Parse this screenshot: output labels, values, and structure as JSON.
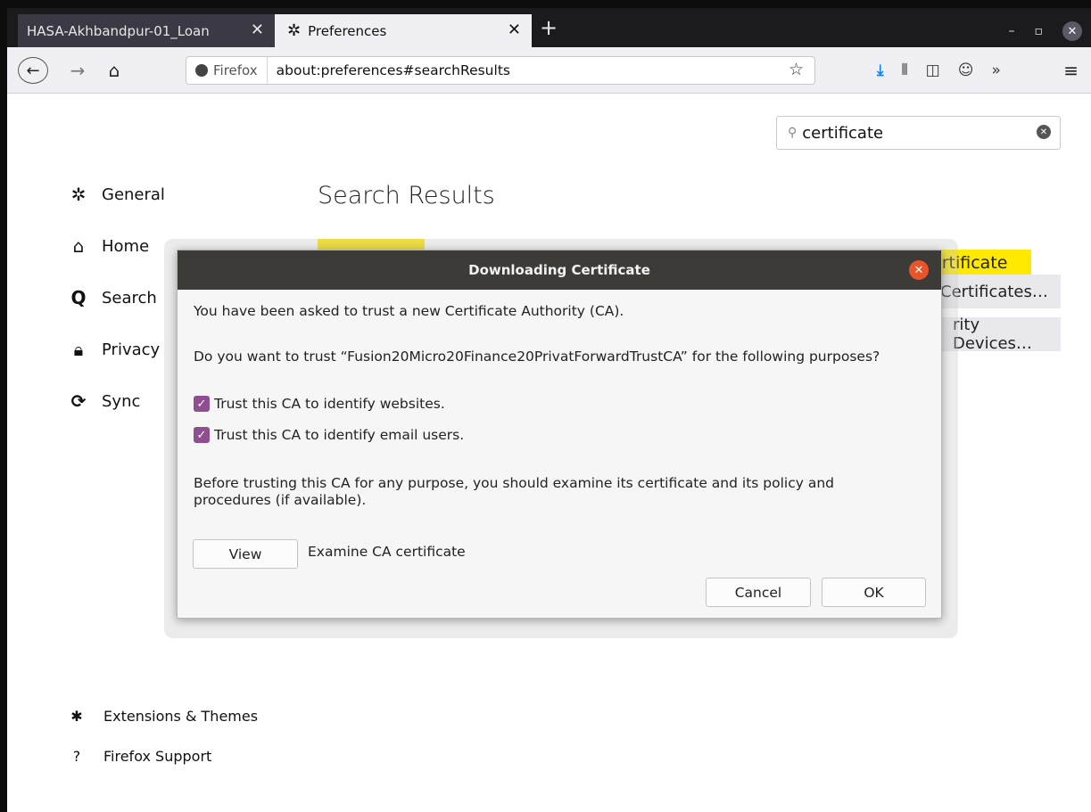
{
  "tabs": [
    {
      "title": "HASA-Akhbandpur-01_Loan",
      "close": "✕"
    },
    {
      "title": "Preferences",
      "icon": "gear-icon",
      "close": "✕"
    }
  ],
  "new_tab": "+",
  "window_controls": {
    "minimize": "–",
    "restore": "▫",
    "close": "✕"
  },
  "nav": {
    "back": "←",
    "forward": "→",
    "home": "⌂",
    "identity": "Firefox",
    "url": "about:preferences#searchResults",
    "star": "☆"
  },
  "toolbar_icons": {
    "download": "⤓",
    "library": "⫴",
    "sidebar": "◫",
    "account": "☺",
    "overflow": "»",
    "menu": "≡"
  },
  "search": {
    "value": "certificate",
    "clear": "✕"
  },
  "categories": [
    {
      "label": "General",
      "icon": "gear-icon",
      "glyph": "✲"
    },
    {
      "label": "Home",
      "icon": "home-icon",
      "glyph": "⌂"
    },
    {
      "label": "Search",
      "icon": "search-icon",
      "glyph": "Q"
    },
    {
      "label": "Privacy",
      "icon": "lock-icon",
      "glyph": "🔒︎"
    },
    {
      "label": "Sync",
      "icon": "sync-icon",
      "glyph": "⟳"
    }
  ],
  "results": {
    "title": "Search Results",
    "btn1": "ertificate",
    "btn2": "Certificates…",
    "btn3": "rity Devices…"
  },
  "footer": [
    {
      "label": "Extensions & Themes",
      "icon": "puzzle-icon",
      "glyph": "✱"
    },
    {
      "label": "Firefox Support",
      "icon": "help-icon",
      "glyph": "?"
    }
  ],
  "dialog": {
    "title": "Downloading Certificate",
    "line1": "You have been asked to trust a new Certificate Authority (CA).",
    "line2": "Do you want to trust “Fusion20Micro20Finance20PrivatForwardTrustCA” for the following purposes?",
    "check1": "Trust this CA to identify websites.",
    "check2": "Trust this CA to identify email users.",
    "line3": "Before trusting this CA for any purpose, you should examine its certificate and its policy and procedures (if available).",
    "view_button": "View",
    "view_desc": "Examine CA certificate",
    "cancel_button": "Cancel",
    "ok_button": "OK",
    "check1_checked": true,
    "check2_checked": true
  },
  "colors": {
    "checkbox": "#8f4e8f",
    "dialog_title_bg": "#3c3b37",
    "close_button": "#e9542a",
    "highlight": "#ffe900"
  }
}
